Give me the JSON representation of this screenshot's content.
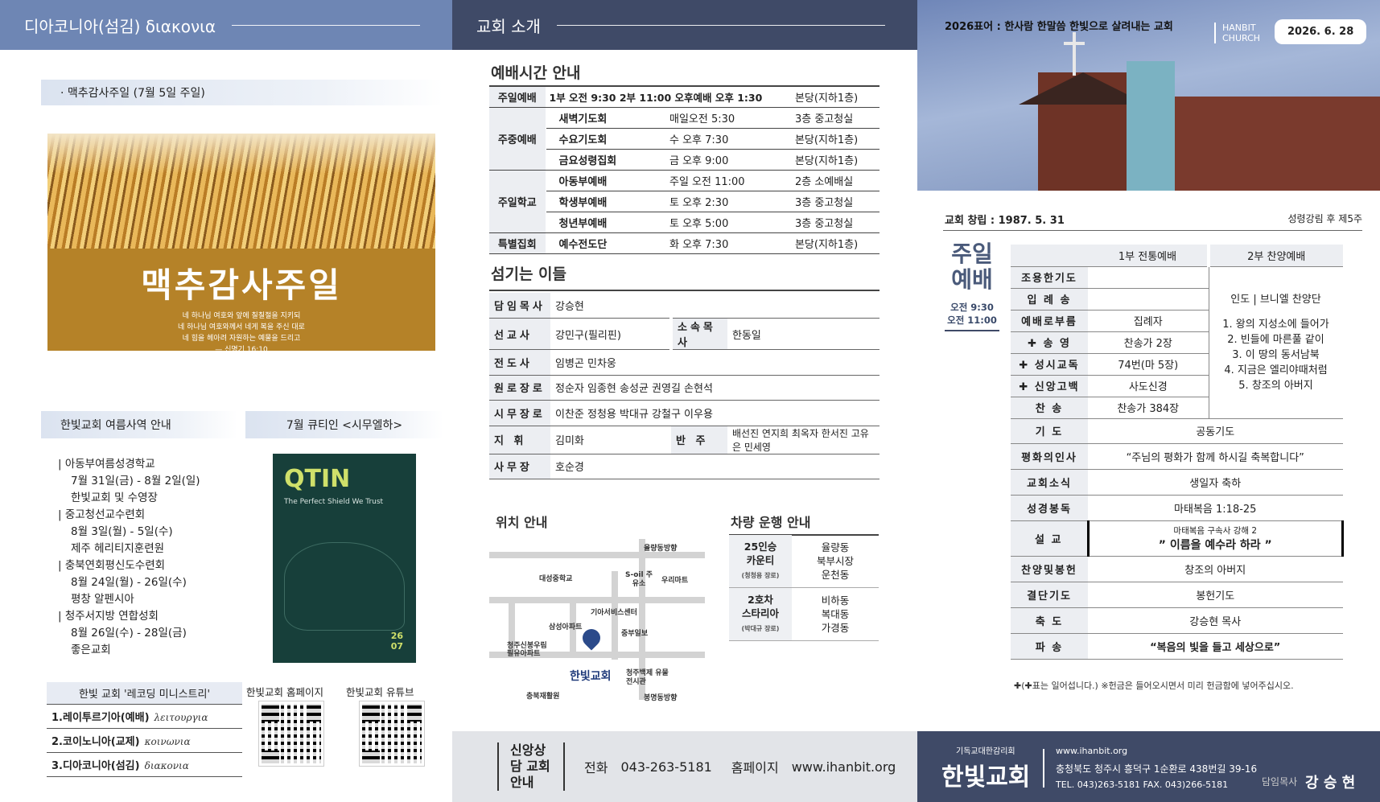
{
  "left": {
    "header": "디아코니아(섬김) διακονια",
    "strip1": "· 맥추감사주일 (7월 5일 주일)",
    "banner_title": "맥추감사주일",
    "banner_verse": [
      "네 하나님 여호와 앞에 칠칠절을 지키되",
      "네 하나님 여호와께서 네게 복을 주신 대로",
      "네 힘을 헤아려 자원하는 예물을 드리고",
      "— 신명기 16:10"
    ],
    "summer_title": "한빛교회 여름사역 안내",
    "qt_title": "7월 큐티인 <시무엘하>",
    "schedule": [
      "| 아동부여름성경학교",
      "7월 31일(금) - 8월 2일(일)",
      "한빛교회 및 수영장",
      "| 중고청선교수련회",
      "8월 3일(월) - 5일(수)",
      "제주 헤리티지훈련원",
      "| 충북연회평신도수련회",
      "8월 24일(월) - 26일(수)",
      "평창 알펜시아",
      "| 청주서지방 연합성회",
      "8월 26일(수) - 28일(금)",
      "좋은교회"
    ],
    "qt_logo": "QTIN",
    "qt_sub": "The Perfect Shield We Trust",
    "qt_no": [
      "26",
      "07"
    ],
    "recording_title": "한빛 교회 '레코딩 미니스트리'",
    "recording": [
      {
        "k": "1.레이투르기아(예배)",
        "g": "λειτουργια"
      },
      {
        "k": "2.코이노니아(교제)",
        "g": "κοινωνια"
      },
      {
        "k": "3.디아코니아(섬김)",
        "g": "διακονια"
      }
    ],
    "qr_home": "한빛교회 홈페이지",
    "qr_yt": "한빛교회 유튜브"
  },
  "mid": {
    "header": "교회 소개",
    "worship_title": "예배시간 안내",
    "worship": [
      {
        "k": "주일예배",
        "n": "1부 오전 9:30  2부 11:00  오후예배 오후 1:30",
        "t": "",
        "p": "본당(지하1층)"
      },
      {
        "k": "주중예배",
        "n": "새벽기도회",
        "t": "매일오전 5:30",
        "p": "3층 중고청실"
      },
      {
        "k": "",
        "n": "수요기도회",
        "t": "수 오후 7:30",
        "p": "본당(지하1층)"
      },
      {
        "k": "",
        "n": "금요성령집회",
        "t": "금 오후 9:00",
        "p": "본당(지하1층)"
      },
      {
        "k": "주일학교",
        "n": "아동부예배",
        "t": "주일 오전 11:00",
        "p": "2층 소예배실"
      },
      {
        "k": "",
        "n": "학생부예배",
        "t": "토 오후 2:30",
        "p": "3층 중고청실"
      },
      {
        "k": "",
        "n": "청년부예배",
        "t": "토 오후 5:00",
        "p": "3층 중고청실"
      },
      {
        "k": "특별집회",
        "n": "예수전도단",
        "t": "화 오후 7:30",
        "p": "본당(지하1층)"
      }
    ],
    "people_title": "섬기는 이들",
    "people": [
      {
        "k": "담임목사",
        "v": "강승현"
      },
      {
        "k": "선교사",
        "v": "강민구(필리핀)",
        "k2": "소속목사",
        "v2": "한동일"
      },
      {
        "k": "전도사",
        "v": "임병곤  민차웅"
      },
      {
        "k": "원로장로",
        "v": "정순자  임종현  송성균  권영길  손현석"
      },
      {
        "k": "시무장로",
        "v": "이찬준  정청용  박대규  강철구  이우용"
      },
      {
        "k": "지  휘",
        "v": "김미화",
        "k2": "반  주",
        "v2": "배선진 연지희 최옥자 한서진 고유은 민세영"
      },
      {
        "k": "사무장",
        "v": "호순경"
      }
    ],
    "map_title": "위치 안내",
    "map_labels": [
      "율량동방향",
      "대성중학교",
      "S-oil 주유소",
      "우리마트",
      "기아서비스센터",
      "삼성아파트",
      "중부일보",
      "청주신봉우림 필유아파트",
      "한빛교회",
      "청주백제 유물전시관",
      "충북재활원",
      "봉명동방향"
    ],
    "bus_title": "차량 운행 안내",
    "bus": [
      {
        "k": "25인승",
        "k2": "카운티",
        "k3": "(청청용 장로)",
        "v": [
          "율량동",
          "북부시장",
          "운천동"
        ]
      },
      {
        "k": "2호차",
        "k2": "스타리아",
        "k3": "(박대규 장로)",
        "v": [
          "비하동",
          "복대동",
          "가경동"
        ]
      }
    ],
    "footer": {
      "label": "신앙상담 교회안내",
      "phone_k": "전화",
      "phone": "043-263-5181",
      "home_k": "홈페이지",
      "home": "www.ihanbit.org"
    }
  },
  "right": {
    "slogan": "2026표어 : 한사람 한말씀 한빛으로 살려내는 교회",
    "brand": [
      "HANBIT",
      "CHURCH"
    ],
    "date": "2026. 6. 28",
    "estab": "교회 창립 : 1987. 5. 31",
    "pentecost": "성령강림 후 제5주",
    "sunday": "주일 예배",
    "times": [
      "오전 9:30",
      "오전 11:00"
    ],
    "h1": "1부 전통예배",
    "h2": "2부 찬양예배",
    "order": [
      {
        "k": "조용한기도",
        "v": ""
      },
      {
        "k": "입 례 송",
        "v": ""
      },
      {
        "k": "예배로부름",
        "v": "집례자"
      },
      {
        "k": "✚ 송    영",
        "v": "찬송가 2장"
      },
      {
        "k": "✚ 성시교독",
        "v": "74번(마 5장)"
      },
      {
        "k": "✚ 신앙고백",
        "v": "사도신경"
      },
      {
        "k": "찬    송",
        "v": "찬송가 384장"
      }
    ],
    "praise": [
      "인도 | 브니엘 찬양단",
      "1. 왕의 지성소에 들어가",
      "2. 빈들에 마른풀 같이",
      "3. 이 땅의 동서남북",
      "4. 지금은 엘리야때처럼",
      "5. 창조의 아버지"
    ],
    "order2": [
      {
        "k": "기    도",
        "v": "공동기도"
      },
      {
        "k": "평화의인사",
        "v": "“주님의 평화가 함께 하시길 축복합니다”"
      },
      {
        "k": "교회소식",
        "v": "생일자 축하"
      },
      {
        "k": "성경봉독",
        "v": "마태복음 1:18-25"
      },
      {
        "k": "설    교",
        "v": "마태복음 구속사 강해 2",
        "v2": "” 이름을 예수라 하라 ”"
      },
      {
        "k": "찬양및봉헌",
        "v": "창조의 아버지"
      },
      {
        "k": "결단기도",
        "v": "봉헌기도"
      },
      {
        "k": "축    도",
        "v": "강승현 목사"
      },
      {
        "k": "파    송",
        "v": "“복음의 빛을 들고 세상으로”"
      }
    ],
    "note": "✚(✚표는 일어섭니다.) ※헌금은 들어오시면서 미리 헌금함에 넣어주십시오.",
    "footer": {
      "small": "기독교대한감리회",
      "name": "한빛교회",
      "url": "www.ihanbit.org",
      "addr": "충청북도 청주시 흥덕구 1순환로 438번길 39-16",
      "tel": "TEL. 043)263-5181   FAX. 043)266-5181",
      "pastor_k": "담임목사",
      "pastor": "강 승 현"
    }
  }
}
